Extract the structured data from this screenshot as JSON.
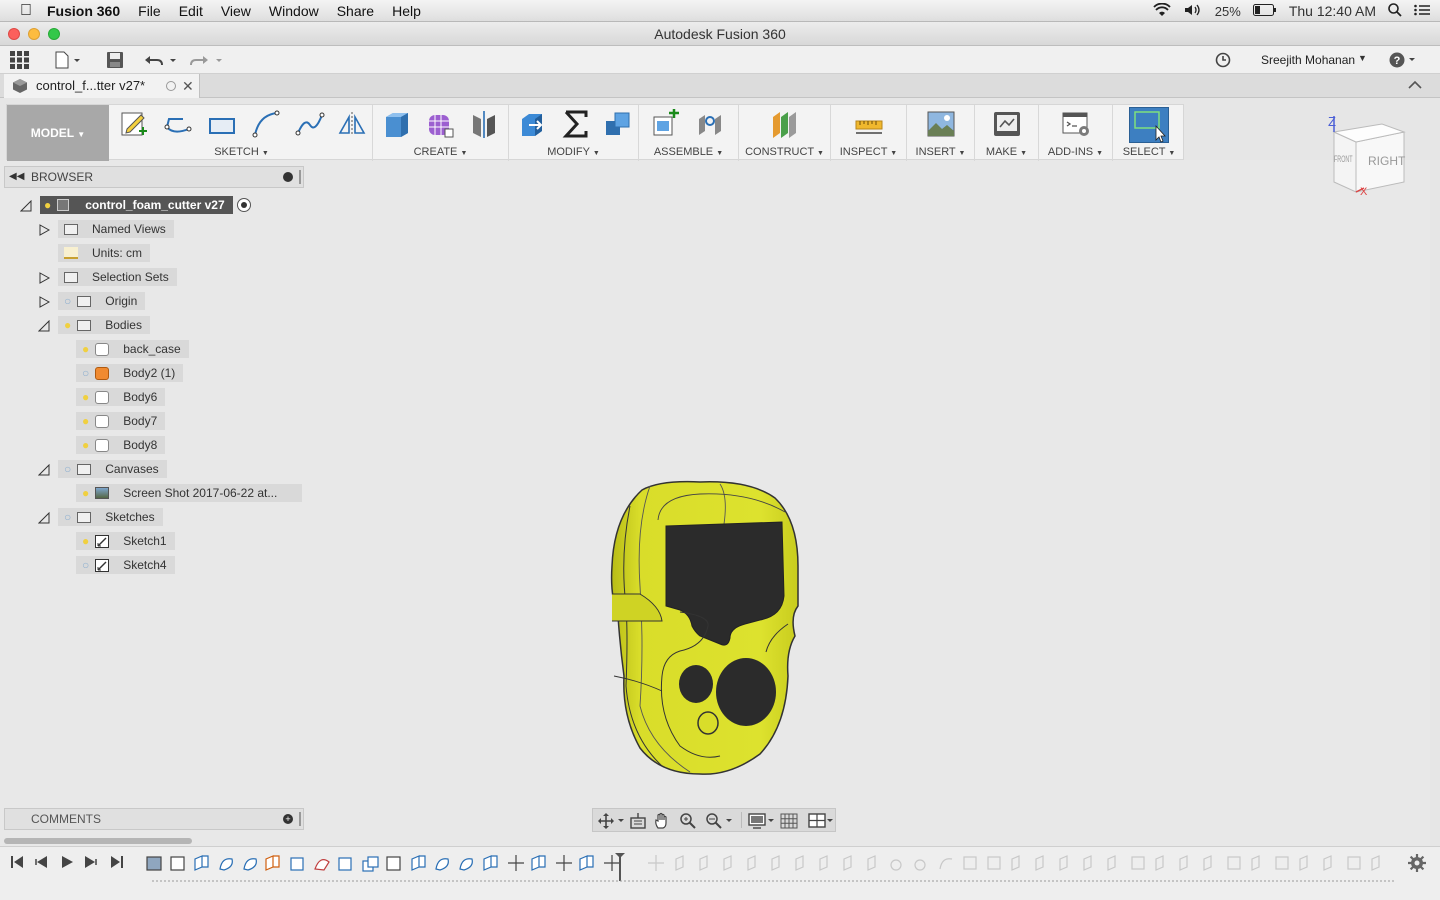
{
  "menubar": {
    "app_name": "Fusion 360",
    "items": [
      "File",
      "Edit",
      "View",
      "Window",
      "Share",
      "Help"
    ],
    "battery": "25%",
    "clock": "Thu 12:40 AM"
  },
  "window": {
    "title": "Autodesk Fusion 360"
  },
  "quickbar": {
    "user": "Sreejith Mohanan"
  },
  "document_tab": {
    "title": "control_f...tter v27*"
  },
  "toolbar": {
    "workspace": "MODEL",
    "groups": [
      "SKETCH",
      "CREATE",
      "MODIFY",
      "ASSEMBLE",
      "CONSTRUCT",
      "INSPECT",
      "INSERT",
      "MAKE",
      "ADD-INS",
      "SELECT"
    ]
  },
  "browser": {
    "title": "BROWSER",
    "root": "control_foam_cutter v27",
    "named_views": "Named Views",
    "units": "Units: cm",
    "selection_sets": "Selection Sets",
    "origin": "Origin",
    "bodies": "Bodies",
    "body_items": [
      "back_case",
      "Body2 (1)",
      "Body6",
      "Body7",
      "Body8"
    ],
    "canvases": "Canvases",
    "canvas_item": "Screen Shot 2017-06-22 at...",
    "sketches": "Sketches",
    "sketch_items": [
      "Sketch1",
      "Sketch4"
    ]
  },
  "comments": {
    "title": "COMMENTS"
  },
  "viewcube": {
    "front": "FRONT",
    "right": "RIGHT",
    "z_axis": "Z",
    "x_axis": "X"
  },
  "colors": {
    "model_yellow": "#d9dd2a",
    "model_dark": "#2b2b2b",
    "select_blue": "#3d7fc1"
  }
}
